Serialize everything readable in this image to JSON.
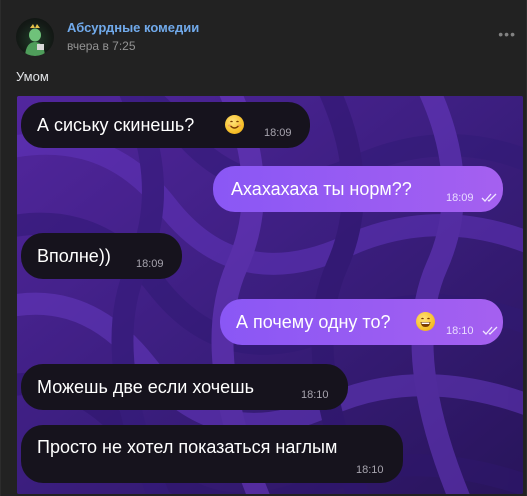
{
  "post": {
    "author": "Абсурдные комедии",
    "time": "вчера в 7:25",
    "more_icon": "more-horizontal-icon",
    "text": "Умом"
  },
  "chat": {
    "messages": [
      {
        "direction": "in",
        "text": "А сиську скинешь?",
        "emoji": "smiling-face-icon",
        "time": "18:09"
      },
      {
        "direction": "out",
        "text": "Ахахахаха ты норм??",
        "time": "18:09",
        "read": true
      },
      {
        "direction": "in",
        "text": "Вполне))",
        "time": "18:09"
      },
      {
        "direction": "out",
        "text": "А почему одну то?",
        "emoji": "grinning-face-icon",
        "time": "18:10",
        "read": true
      },
      {
        "direction": "in",
        "text": "Можешь две если хочешь",
        "time": "18:10"
      },
      {
        "direction": "in",
        "text": "Просто не хотел показаться наглым",
        "time": "18:10"
      }
    ]
  },
  "colors": {
    "link": "#71aaeb",
    "incoming_bubble": "#16131d",
    "outgoing_bubble": "#9a5cf3",
    "background": "#222222"
  }
}
